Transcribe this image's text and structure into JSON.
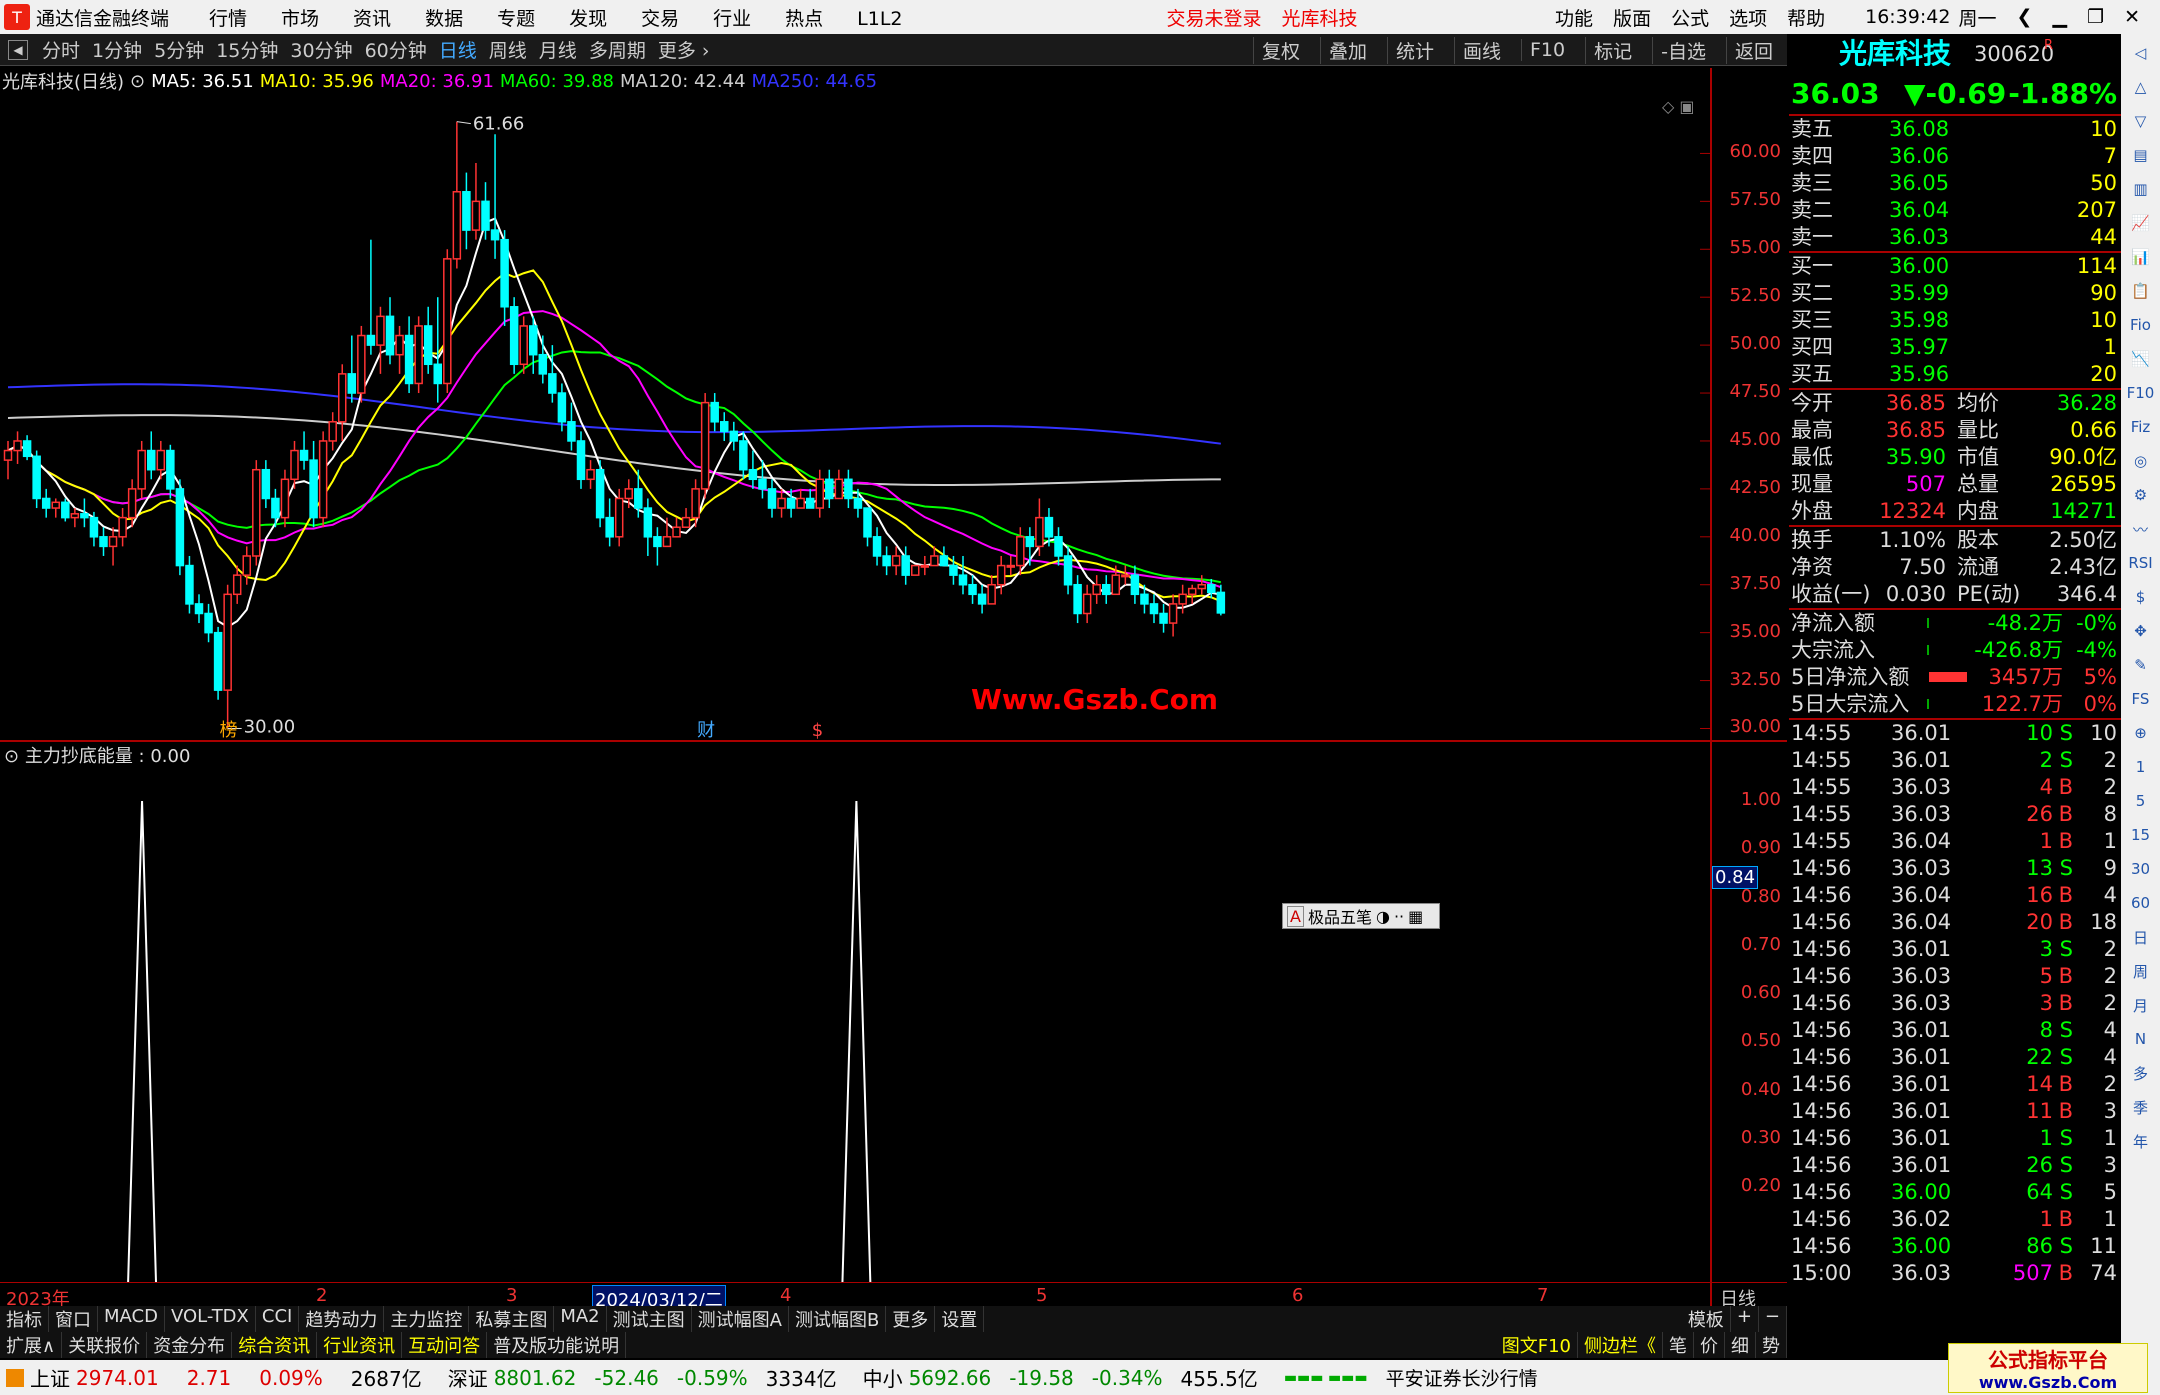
{
  "app": {
    "title": "通达信金融终端",
    "menu": [
      "行情",
      "市场",
      "资讯",
      "数据",
      "专题",
      "发现",
      "交易",
      "行业",
      "热点",
      "L1L2"
    ],
    "login": "交易未登录",
    "stock_name_top": "光库科技",
    "right_menu": [
      "功能",
      "版面",
      "公式",
      "选项",
      "帮助"
    ],
    "time": "16:39:42",
    "weekday": "周一"
  },
  "toolbar": {
    "periods": [
      "分时",
      "1分钟",
      "5分钟",
      "15分钟",
      "30分钟",
      "60分钟",
      "日线",
      "周线",
      "月线",
      "多周期",
      "更多"
    ],
    "active": "日线",
    "right": [
      "复权",
      "叠加",
      "统计",
      "画线",
      "F10",
      "标记",
      "-自选",
      "返回"
    ]
  },
  "legend": {
    "title": "光库科技(日线)",
    "ma5": "MA5: 36.51",
    "ma10": "MA10: 35.96",
    "ma20": "MA20: 36.91",
    "ma60": "MA60: 39.88",
    "ma120": "MA120: 42.44",
    "ma250": "MA250: 44.65",
    "colors": {
      "ma5": "#ffffff",
      "ma10": "#ffff00",
      "ma20": "#ff00ff",
      "ma60": "#00ff00",
      "ma120": "#cccccc",
      "ma250": "#3333ff"
    }
  },
  "chart_data": [
    {
      "type": "candlestick",
      "title": "光库科技(日线)",
      "y_ticks": [
        "60.00",
        "57.50",
        "55.00",
        "52.50",
        "50.00",
        "47.50",
        "45.00",
        "42.50",
        "40.00",
        "37.50",
        "35.00",
        "32.50",
        "30.00"
      ],
      "ylim": [
        29.4,
        63.1
      ],
      "high_label": "61.66",
      "low_label": "30.00",
      "candles": [
        [
          44,
          45,
          43,
          44.5
        ],
        [
          44.5,
          45.5,
          43.8,
          45
        ],
        [
          45,
          45.3,
          44,
          44.2
        ],
        [
          44.2,
          44.5,
          41.5,
          42
        ],
        [
          42,
          42.5,
          41,
          41.5
        ],
        [
          41.5,
          42,
          41,
          41.8
        ],
        [
          41.8,
          42,
          40.8,
          41
        ],
        [
          41,
          41.5,
          40.5,
          41.2
        ],
        [
          41.2,
          42,
          40.5,
          41
        ],
        [
          41,
          41.3,
          39.5,
          40
        ],
        [
          40,
          40.5,
          39,
          39.5
        ],
        [
          39.5,
          40.5,
          38.5,
          40
        ],
        [
          40,
          41.5,
          39.5,
          41
        ],
        [
          41,
          43,
          40.5,
          42.5
        ],
        [
          42.5,
          45,
          42,
          44.5
        ],
        [
          44.5,
          45.5,
          43,
          43.5
        ],
        [
          43.5,
          45,
          43,
          44.5
        ],
        [
          44.5,
          44.8,
          42,
          42.5
        ],
        [
          42.5,
          43,
          38,
          38.5
        ],
        [
          38.5,
          39,
          36,
          36.5
        ],
        [
          36.5,
          37,
          35.5,
          36
        ],
        [
          36,
          36.5,
          34.5,
          35
        ],
        [
          35,
          35.3,
          31.5,
          32
        ],
        [
          32,
          37.5,
          30,
          37
        ],
        [
          37,
          38.5,
          36.5,
          38
        ],
        [
          38,
          39.5,
          37.5,
          39
        ],
        [
          39,
          44,
          38.5,
          43.5
        ],
        [
          43.5,
          44,
          41.5,
          42
        ],
        [
          42,
          42.5,
          40.5,
          41
        ],
        [
          41,
          43.5,
          40.5,
          43
        ],
        [
          43,
          45,
          42.5,
          44.5
        ],
        [
          44.5,
          45.5,
          43.5,
          44
        ],
        [
          44,
          45,
          40.5,
          41
        ],
        [
          41,
          45.5,
          40.5,
          45
        ],
        [
          45,
          46.5,
          44.5,
          46
        ],
        [
          46,
          49,
          45,
          48.5
        ],
        [
          48.5,
          50.5,
          47,
          47.5
        ],
        [
          47.5,
          51,
          47,
          50.5
        ],
        [
          50.5,
          55.5,
          49.5,
          50
        ],
        [
          50,
          52,
          48.5,
          51.5
        ],
        [
          51.5,
          52.5,
          49,
          49.5
        ],
        [
          49.5,
          51,
          48.5,
          50.5
        ],
        [
          50.5,
          51.5,
          47.5,
          48
        ],
        [
          48,
          51.5,
          47.5,
          51
        ],
        [
          51,
          52,
          48.5,
          49
        ],
        [
          49,
          52.5,
          47,
          48
        ],
        [
          48,
          55,
          47.5,
          54.5
        ],
        [
          54.5,
          61.66,
          54,
          58
        ],
        [
          58,
          59,
          55,
          56
        ],
        [
          56,
          59.5,
          55.5,
          57.5
        ],
        [
          57.5,
          58.5,
          55.5,
          56
        ],
        [
          56,
          61,
          54.5,
          55.5
        ],
        [
          55.5,
          56,
          51,
          52
        ],
        [
          52,
          52.5,
          48.5,
          49
        ],
        [
          49,
          51.5,
          48.5,
          51
        ],
        [
          51,
          51.5,
          48.5,
          49.5
        ],
        [
          49.5,
          50.5,
          48,
          48.5
        ],
        [
          48.5,
          50,
          47,
          47.5
        ],
        [
          47.5,
          48,
          45.5,
          46
        ],
        [
          46,
          47,
          44.5,
          45
        ],
        [
          45,
          45.5,
          42.5,
          43
        ],
        [
          43,
          44,
          42.5,
          43.5
        ],
        [
          43.5,
          44,
          40.5,
          41
        ],
        [
          41,
          42,
          39.5,
          40
        ],
        [
          40,
          42.5,
          39.5,
          42
        ],
        [
          42,
          43,
          41.5,
          42.5
        ],
        [
          42.5,
          43.5,
          41,
          41.5
        ],
        [
          41.5,
          42,
          39,
          40
        ],
        [
          40,
          40.5,
          38.5,
          39.5
        ],
        [
          39.5,
          41,
          39.5,
          40
        ],
        [
          40,
          41,
          40,
          40.5
        ],
        [
          40.5,
          41.5,
          40.5,
          41
        ],
        [
          41,
          43,
          40.5,
          42.5
        ],
        [
          42.5,
          47.5,
          42,
          47
        ],
        [
          47,
          47.5,
          45.5,
          46
        ],
        [
          46,
          46.5,
          45,
          45.5
        ],
        [
          45.5,
          46,
          44.5,
          45
        ],
        [
          45,
          45.5,
          43,
          43.5
        ],
        [
          43.5,
          44.5,
          42.5,
          43
        ],
        [
          43,
          44,
          42,
          42.5
        ],
        [
          42.5,
          43,
          41,
          41.5
        ],
        [
          41.5,
          42.5,
          41,
          42
        ],
        [
          42,
          42.5,
          41,
          41.5
        ],
        [
          41.5,
          42.5,
          41.5,
          42
        ],
        [
          42,
          42.5,
          41.5,
          41.5
        ],
        [
          41.5,
          43.5,
          41,
          43
        ],
        [
          43,
          43.5,
          41.5,
          42
        ],
        [
          42,
          43.5,
          42,
          43
        ],
        [
          43,
          43.5,
          41.5,
          42
        ],
        [
          42,
          42.5,
          41,
          41.5
        ],
        [
          41.5,
          41.5,
          39.5,
          40
        ],
        [
          40,
          40.5,
          38.5,
          39
        ],
        [
          39,
          39.5,
          38,
          38.5
        ],
        [
          38.5,
          39.5,
          38,
          39
        ],
        [
          39,
          39.5,
          37.5,
          38
        ],
        [
          38,
          38.5,
          38,
          38.5
        ],
        [
          38.5,
          39,
          38,
          38.5
        ],
        [
          38.5,
          39.5,
          38.5,
          39
        ],
        [
          39,
          39.5,
          38.5,
          38.5
        ],
        [
          38.5,
          39,
          37.5,
          38
        ],
        [
          38,
          39,
          37,
          37.5
        ],
        [
          37.5,
          38,
          36.5,
          37
        ],
        [
          37,
          37.5,
          36,
          36.5
        ],
        [
          36.5,
          38,
          36.5,
          37.5
        ],
        [
          37.5,
          39,
          37,
          38.5
        ],
        [
          38.5,
          39,
          38,
          38.5
        ],
        [
          38.5,
          40.5,
          38,
          40
        ],
        [
          40,
          40.5,
          38.5,
          39.5
        ],
        [
          39.5,
          42,
          39,
          41
        ],
        [
          41,
          41.5,
          39.5,
          40
        ],
        [
          40,
          40.5,
          38.5,
          39
        ],
        [
          39,
          39.5,
          37,
          37.5
        ],
        [
          37.5,
          38,
          35.5,
          36
        ],
        [
          36,
          37.5,
          35.5,
          37
        ],
        [
          37,
          38,
          36.5,
          37.5
        ],
        [
          37.5,
          38,
          36.5,
          37
        ],
        [
          37,
          38.5,
          37,
          38
        ],
        [
          38,
          38.5,
          37.5,
          38
        ],
        [
          38,
          38.5,
          36.5,
          37
        ],
        [
          37,
          37.5,
          36,
          36.5
        ],
        [
          36.5,
          37,
          35.5,
          36
        ],
        [
          36,
          36.5,
          35,
          35.5
        ],
        [
          35.5,
          37,
          34.8,
          36.5
        ],
        [
          36.5,
          37.5,
          36,
          37
        ],
        [
          37,
          37.5,
          36.5,
          37.3
        ],
        [
          37.3,
          38,
          37,
          37.5
        ],
        [
          37.5,
          37.8,
          36.8,
          37.1
        ],
        [
          37.1,
          37.5,
          35.9,
          36.03
        ]
      ]
    },
    {
      "type": "line",
      "title": "主力抄底能量",
      "value_label": "0.00",
      "current": "0.84",
      "y_ticks": [
        "1.00",
        "0.90",
        "0.80",
        "0.70",
        "0.60",
        "0.50",
        "0.40",
        "0.30",
        "0.20"
      ],
      "ylim": [
        0,
        1.06
      ],
      "spikes": [
        {
          "index": 10,
          "value": 1
        },
        {
          "index": 78,
          "value": 1
        }
      ]
    }
  ],
  "markers": {
    "bang": "榜",
    "cai": "财",
    "dollar": "$"
  },
  "watermark": "Www.Gszb.Com",
  "ime": {
    "label": "A",
    "name": "极品五笔"
  },
  "date_axis": {
    "year": "2023年",
    "highlight": "2024/03/12/二",
    "months": [
      "2",
      "3",
      "4",
      "5",
      "6",
      "7"
    ],
    "period": "日线"
  },
  "tabs1": [
    "指标",
    "窗口",
    "MACD",
    "VOL-TDX",
    "CCI",
    "趋势动力",
    "主力监控",
    "私募主图",
    "MA2",
    "测试主图",
    "测试幅图A",
    "测试幅图B",
    "更多",
    "设置"
  ],
  "tabs1_right": [
    "模板",
    "+",
    "−"
  ],
  "tabs2": [
    "扩展∧",
    "关联报价",
    "资金分布",
    "综合资讯",
    "行业资讯",
    "互动问答",
    "普及版功能说明"
  ],
  "tabs2_right": [
    "图文F10",
    "侧边栏《",
    "笔",
    "价",
    "细",
    "势"
  ],
  "quote": {
    "name": "光库科技",
    "code": "300620",
    "flag": "R",
    "price": "36.03",
    "change": "▼-0.69",
    "pct": "-1.88%",
    "asks": [
      [
        "卖五",
        "36.08",
        "10"
      ],
      [
        "卖四",
        "36.06",
        "7"
      ],
      [
        "卖三",
        "36.05",
        "50"
      ],
      [
        "卖二",
        "36.04",
        "207"
      ],
      [
        "卖一",
        "36.03",
        "44"
      ]
    ],
    "bids": [
      [
        "买一",
        "36.00",
        "114"
      ],
      [
        "买二",
        "35.99",
        "90"
      ],
      [
        "买三",
        "35.98",
        "10"
      ],
      [
        "买四",
        "35.97",
        "1"
      ],
      [
        "买五",
        "35.96",
        "20"
      ]
    ],
    "stats": [
      [
        "今开",
        "36.85",
        "均价",
        "36.28"
      ],
      [
        "最高",
        "36.85",
        "量比",
        "0.66"
      ],
      [
        "最低",
        "35.90",
        "市值",
        "90.0亿"
      ],
      [
        "现量",
        "507",
        "总量",
        "26595"
      ],
      [
        "外盘",
        "12324",
        "内盘",
        "14271"
      ]
    ],
    "stats2": [
      [
        "换手",
        "1.10%",
        "股本",
        "2.50亿"
      ],
      [
        "净资",
        "7.50",
        "流通",
        "2.43亿"
      ],
      [
        "收益(一)",
        "0.030",
        "PE(动)",
        "346.4"
      ]
    ],
    "flows": [
      [
        "净流入额",
        "-48.2万",
        "-0%"
      ],
      [
        "大宗流入",
        "-426.8万",
        "-4%"
      ],
      [
        "5日净流入额",
        "3457万",
        "5%"
      ],
      [
        "5日大宗流入",
        "122.7万",
        "0%"
      ]
    ],
    "ticks": [
      [
        "14:55",
        "36.01",
        "10",
        "S",
        "10"
      ],
      [
        "14:55",
        "36.01",
        "2",
        "S",
        "2"
      ],
      [
        "14:55",
        "36.03",
        "4",
        "B",
        "2"
      ],
      [
        "14:55",
        "36.03",
        "26",
        "B",
        "8"
      ],
      [
        "14:55",
        "36.04",
        "1",
        "B",
        "1"
      ],
      [
        "14:56",
        "36.03",
        "13",
        "S",
        "9"
      ],
      [
        "14:56",
        "36.04",
        "16",
        "B",
        "4"
      ],
      [
        "14:56",
        "36.04",
        "20",
        "B",
        "18"
      ],
      [
        "14:56",
        "36.01",
        "3",
        "S",
        "2"
      ],
      [
        "14:56",
        "36.03",
        "5",
        "B",
        "2"
      ],
      [
        "14:56",
        "36.03",
        "3",
        "B",
        "2"
      ],
      [
        "14:56",
        "36.01",
        "8",
        "S",
        "4"
      ],
      [
        "14:56",
        "36.01",
        "22",
        "S",
        "4"
      ],
      [
        "14:56",
        "36.01",
        "14",
        "B",
        "2"
      ],
      [
        "14:56",
        "36.01",
        "11",
        "B",
        "3"
      ],
      [
        "14:56",
        "36.01",
        "1",
        "S",
        "1"
      ],
      [
        "14:56",
        "36.01",
        "26",
        "S",
        "3"
      ],
      [
        "14:56",
        "36.00",
        "64",
        "S",
        "5"
      ],
      [
        "14:56",
        "36.02",
        "1",
        "B",
        "1"
      ],
      [
        "14:56",
        "36.00",
        "86",
        "S",
        "11"
      ],
      [
        "15:00",
        "36.03",
        "507",
        "B",
        "74"
      ]
    ]
  },
  "status": {
    "sh": "上证",
    "sh_v": "2974.01",
    "sh_c": "2.71",
    "sh_p": "0.09%",
    "sh_a": "2687亿",
    "sz": "深证",
    "sz_v": "8801.62",
    "sz_c": "-52.46",
    "sz_p": "-0.59%",
    "sz_a": "3334亿",
    "zx": "中小",
    "zx_v": "5692.66",
    "zx_c": "-19.58",
    "zx_p": "-0.34%",
    "zx_a": "455.5亿",
    "src": "平安证券长沙行情",
    "brand1": "公式指标平台",
    "brand2": "www.Gszb.Com"
  },
  "sidebar_tools": [
    "◁",
    "△",
    "▽",
    "▤",
    "▥",
    "📈",
    "📊",
    "📋",
    "Fio",
    "📉",
    "F10",
    "Fiz",
    "◎",
    "⚙",
    "〰",
    "RSI",
    "$",
    "✥",
    "✎",
    "FS",
    "⊕",
    "1",
    "5",
    "15",
    "30",
    "60",
    "日",
    "周",
    "月",
    "N",
    "多",
    "季",
    "年"
  ]
}
